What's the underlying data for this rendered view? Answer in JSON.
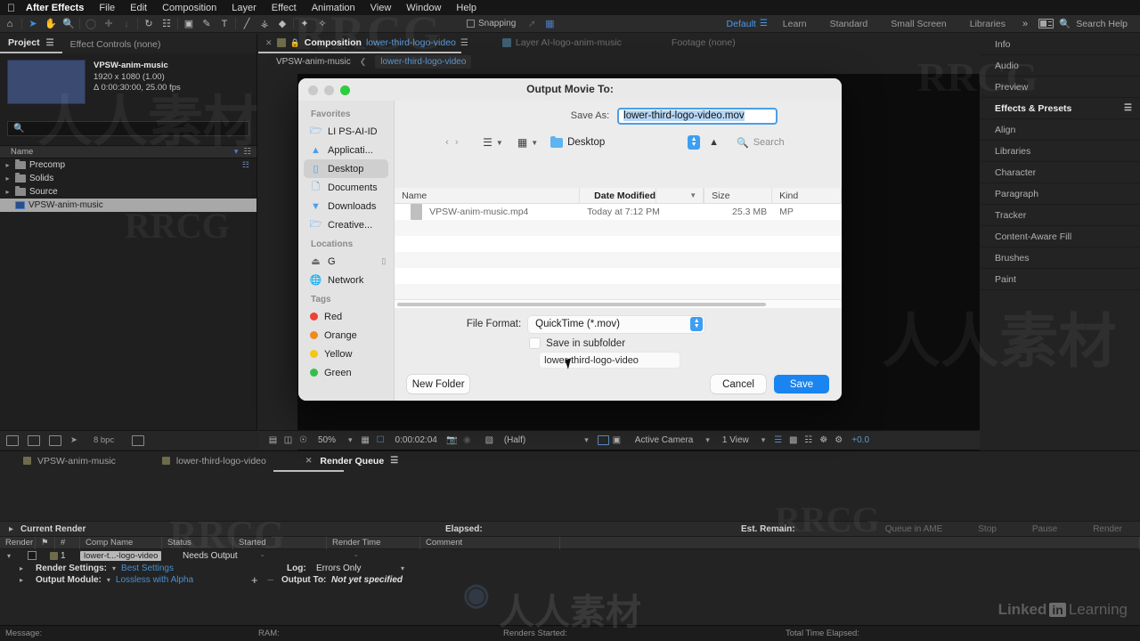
{
  "menubar": {
    "apple": "",
    "items": [
      "After Effects",
      "File",
      "Edit",
      "Composition",
      "Layer",
      "Effect",
      "Animation",
      "View",
      "Window",
      "Help"
    ]
  },
  "toolbar": {
    "snapping_label": "Snapping",
    "workspaces": [
      "Default",
      "Learn",
      "Standard",
      "Small Screen",
      "Libraries"
    ],
    "selected_workspace": "Default",
    "overflow": "»",
    "search_help": "Search Help"
  },
  "project_panel": {
    "tabs": [
      {
        "label": "Project",
        "active": true
      },
      {
        "label": "Effect Controls (none)",
        "active": false
      }
    ],
    "preview": {
      "title": "VPSW-anim-music",
      "resolution": "1920 x 1080 (1.00)",
      "duration": "Δ 0:00:30:00, 25.00 fps"
    },
    "search_placeholder": "",
    "column_header": "Name",
    "items": [
      {
        "label": "Precomp",
        "type": "folder",
        "selected": false
      },
      {
        "label": "Solids",
        "type": "folder",
        "selected": false
      },
      {
        "label": "Source",
        "type": "folder",
        "selected": false
      },
      {
        "label": "VPSW-anim-music",
        "type": "comp",
        "selected": true
      }
    ],
    "footer": {
      "bpc": "8 bpc"
    }
  },
  "comp_panel": {
    "tabs": [
      {
        "prefix": "Composition",
        "name": "lower-third-logo-video",
        "active": true
      },
      {
        "prefix": "Layer AI-logo-anim-music",
        "name": "",
        "active": false
      },
      {
        "prefix": "Footage (none)",
        "name": "",
        "active": false
      }
    ],
    "breadcrumb": {
      "parent": "VPSW-anim-music",
      "current": "lower-third-logo-video"
    },
    "bottom_bar": {
      "zoom": "50%",
      "time": "0:00:02:04",
      "resolution": "(Half)",
      "camera": "Active Camera",
      "views": "1 View",
      "exposure": "+0.0"
    }
  },
  "right_panel": {
    "items": [
      {
        "label": "Info",
        "active": false
      },
      {
        "label": "Audio",
        "active": false
      },
      {
        "label": "Preview",
        "active": false
      },
      {
        "label": "Effects & Presets",
        "active": true
      },
      {
        "label": "Align",
        "active": false
      },
      {
        "label": "Libraries",
        "active": false
      },
      {
        "label": "Character",
        "active": false
      },
      {
        "label": "Paragraph",
        "active": false
      },
      {
        "label": "Tracker",
        "active": false
      },
      {
        "label": "Content-Aware Fill",
        "active": false
      },
      {
        "label": "Brushes",
        "active": false
      },
      {
        "label": "Paint",
        "active": false
      }
    ]
  },
  "render_queue": {
    "tabs": [
      {
        "label": "VPSW-anim-music",
        "active": false
      },
      {
        "label": "lower-third-logo-video",
        "active": false
      },
      {
        "label": "Render Queue",
        "active": true
      }
    ],
    "current_render_label": "Current Render",
    "elapsed_label": "Elapsed:",
    "est_remain_label": "Est. Remain:",
    "buttons": [
      "Queue in AME",
      "Stop",
      "Pause",
      "Render"
    ],
    "columns": [
      "Render",
      "",
      "#",
      "Comp Name",
      "Status",
      "Started",
      "Render Time",
      "Comment"
    ],
    "row": {
      "number": "1",
      "comp_name": "lower-t...-logo-video",
      "status": "Needs Output",
      "started": "-",
      "render_time": "-",
      "comment": ""
    },
    "render_settings_label": "Render Settings:",
    "render_settings_value": "Best Settings",
    "output_module_label": "Output Module:",
    "output_module_value": "Lossless with Alpha",
    "log_label": "Log:",
    "log_value": "Errors Only",
    "output_to_label": "Output To:",
    "output_to_value": "Not yet specified"
  },
  "statusbar": {
    "message_label": "Message:",
    "ram_label": "RAM:",
    "renders_started_label": "Renders Started:",
    "total_time_label": "Total Time Elapsed:"
  },
  "dialog": {
    "title": "Output Movie To:",
    "save_as_label": "Save As:",
    "save_as_value": "lower-third-logo-video.mov",
    "location": "Desktop",
    "search_placeholder": "Search",
    "sidebar": {
      "favorites_label": "Favorites",
      "favorites": [
        {
          "label": "LI PS-AI-ID",
          "icon": "folder-icon",
          "selected": false
        },
        {
          "label": "Applicati...",
          "icon": "applications-icon",
          "selected": false
        },
        {
          "label": "Desktop",
          "icon": "desktop-icon",
          "selected": true
        },
        {
          "label": "Documents",
          "icon": "document-icon",
          "selected": false
        },
        {
          "label": "Downloads",
          "icon": "download-icon",
          "selected": false
        },
        {
          "label": "Creative...",
          "icon": "folder-icon",
          "selected": false
        }
      ],
      "locations_label": "Locations",
      "locations": [
        {
          "label": "G",
          "icon": "drive-icon"
        },
        {
          "label": "Network",
          "icon": "network-icon"
        }
      ],
      "tags_label": "Tags",
      "tags": [
        {
          "label": "Red",
          "color": "#ef4136"
        },
        {
          "label": "Orange",
          "color": "#f08a1c"
        },
        {
          "label": "Yellow",
          "color": "#f2c715"
        },
        {
          "label": "Green",
          "color": "#35bf4a"
        }
      ]
    },
    "file_columns": [
      "Name",
      "Date Modified",
      "Size",
      "Kind"
    ],
    "files": [
      {
        "name": "VPSW-anim-music.mp4",
        "date_modified": "Today at 7:12 PM",
        "size": "25.3 MB",
        "kind": "MP"
      }
    ],
    "file_format_label": "File Format:",
    "file_format_value": "QuickTime (*.mov)",
    "save_in_subfolder_label": "Save in subfolder",
    "subfolder_value": "lower-third-logo-video",
    "new_folder_label": "New Folder",
    "cancel_label": "Cancel",
    "save_label": "Save",
    "accent_color": "#1a84f0"
  },
  "branding": {
    "linkedin": "Linked",
    "in": "in",
    "learning": "Learning"
  }
}
